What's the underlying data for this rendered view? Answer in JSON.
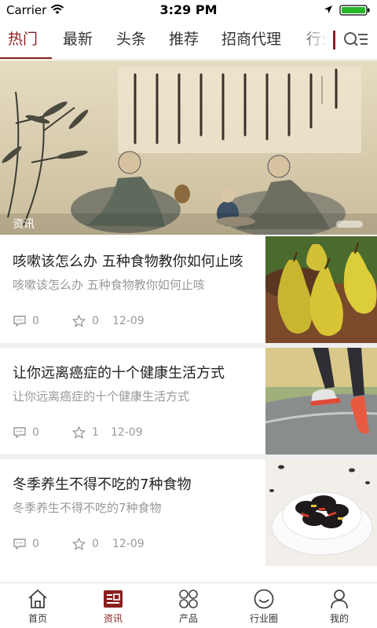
{
  "status_bar": {
    "carrier": "Carrier",
    "time": "3:29 PM",
    "wifi_icon": "wifi-icon",
    "location_icon": "location-arrow-icon",
    "battery_icon": "battery-icon"
  },
  "tabs": [
    {
      "label": "热门",
      "active": true
    },
    {
      "label": "最新",
      "active": false
    },
    {
      "label": "头条",
      "active": false
    },
    {
      "label": "推荐",
      "active": false
    },
    {
      "label": "招商代理",
      "active": false
    },
    {
      "label": "行业",
      "active": false
    }
  ],
  "menu_icon": "search-menu-icon",
  "banner": {
    "caption": "资讯",
    "image": "chinese-painting-sages-with-poem"
  },
  "articles": [
    {
      "title": "咳嗽该怎么办 五种食物教你如何止咳",
      "summary": "咳嗽该怎么办 五种食物教你如何止咳",
      "comments": "0",
      "likes": "0",
      "date": "12-09",
      "thumb": "pears-photo"
    },
    {
      "title": "让你远离癌症的十个健康生活方式",
      "summary": "让你远离癌症的十个健康生活方式",
      "comments": "0",
      "likes": "1",
      "date": "12-09",
      "thumb": "running-shoes-photo"
    },
    {
      "title": "冬季养生不得不吃的7种食物",
      "summary": "冬季养生不得不吃的7种食物",
      "comments": "0",
      "likes": "0",
      "date": "12-09",
      "thumb": "black-fungus-dish-photo"
    }
  ],
  "bottom_nav": [
    {
      "label": "首页",
      "icon": "home-icon",
      "active": false
    },
    {
      "label": "资讯",
      "icon": "news-icon",
      "active": true
    },
    {
      "label": "产品",
      "icon": "grid-products-icon",
      "active": false
    },
    {
      "label": "行业圈",
      "icon": "circle-smile-icon",
      "active": false
    },
    {
      "label": "我的",
      "icon": "user-icon",
      "active": false
    }
  ],
  "colors": {
    "accent": "#8a1f1f",
    "text": "#222222",
    "muted": "#999999",
    "divider": "#efefef"
  }
}
